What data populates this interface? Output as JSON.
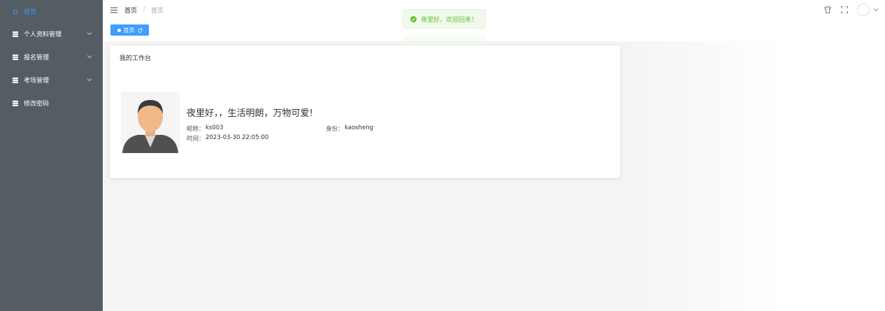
{
  "sidebar": {
    "items": [
      {
        "label": "首页",
        "icon": "home-icon",
        "active": true
      },
      {
        "label": "个人资料管理",
        "icon": "grid-icon",
        "expandable": true
      },
      {
        "label": "报名管理",
        "icon": "grid-icon",
        "expandable": true
      },
      {
        "label": "考场管理",
        "icon": "grid-icon",
        "expandable": true
      },
      {
        "label": "修改密码",
        "icon": "grid-icon",
        "expandable": false
      }
    ]
  },
  "header": {
    "breadcrumb": [
      "首页",
      "首页"
    ],
    "separator": "/"
  },
  "tags": [
    {
      "label": "首页"
    }
  ],
  "toast": {
    "message": "夜里好，欢迎回来！",
    "type": "success"
  },
  "card": {
    "title": "我的工作台",
    "greeting": "夜里好，，生活明朗，万物可爱!",
    "nickname_label": "昵称：",
    "nickname": "ks003",
    "identity_label": "身份：",
    "identity": "kaosheng",
    "time_label": "时间：",
    "time": "2023-03-30 22:05:00"
  },
  "colors": {
    "sidebar_bg": "#545c64",
    "accent": "#409eff",
    "success": "#67c23a"
  }
}
